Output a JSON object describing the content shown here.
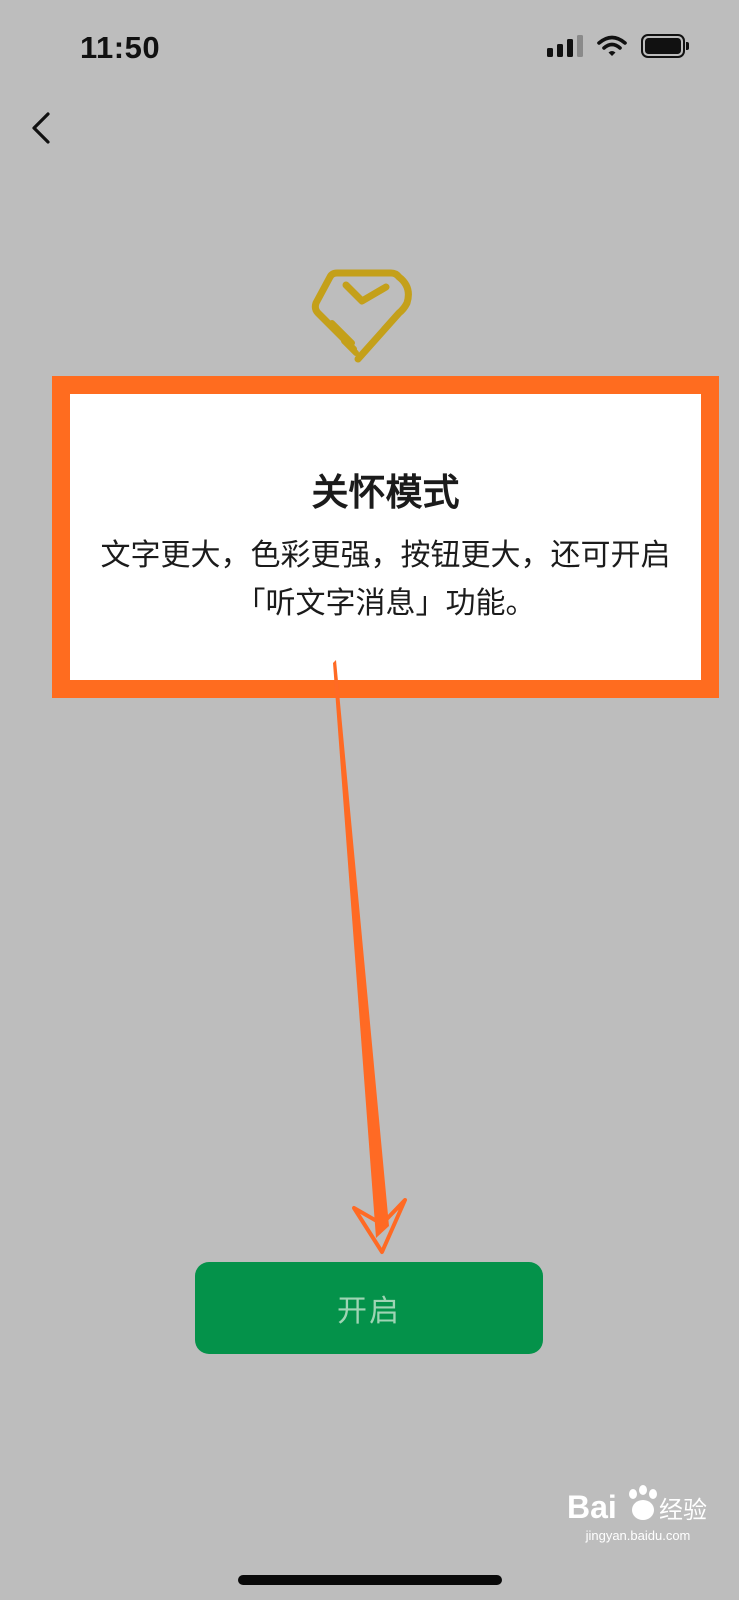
{
  "status_bar": {
    "time": "11:50",
    "icons": [
      "cellular-signal-icon",
      "wifi-icon",
      "battery-icon"
    ]
  },
  "nav": {
    "back_icon": "chevron-left-icon"
  },
  "care_mode": {
    "icon": "care-heart-hand-icon",
    "title": "关怀模式",
    "description": "文字更大，色彩更强，按钮更大，还可开启「听文字消息」功能。"
  },
  "actions": {
    "open_label": "开启"
  },
  "watermark": {
    "text": "Baidu经验",
    "url": "jingyan.baidu.com"
  },
  "colors": {
    "background": "#bdbdbd",
    "highlight_frame": "#ff6c1f",
    "arrow": "#ff6a24",
    "button": "#04924a",
    "button_text": "#9fd4b4",
    "icon_gold": "#c4a01a"
  }
}
